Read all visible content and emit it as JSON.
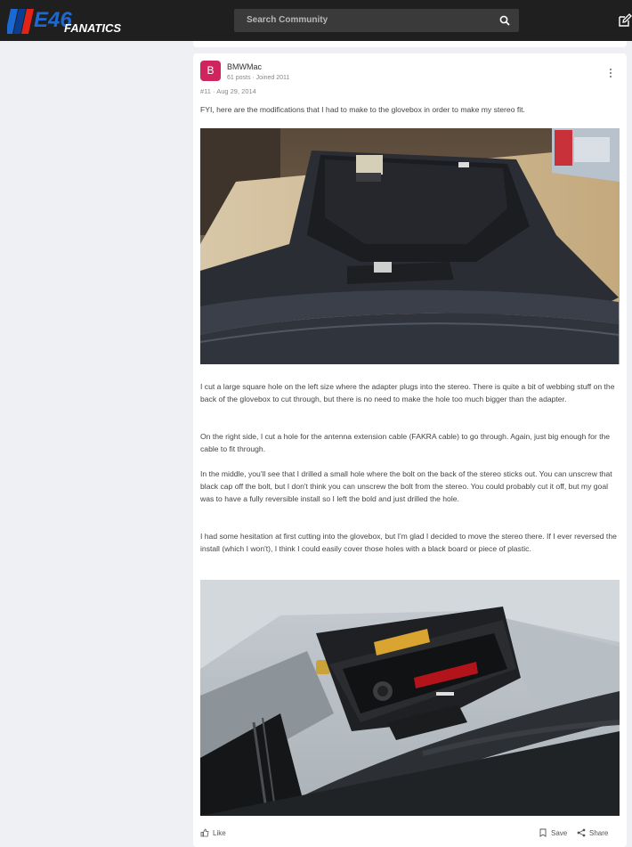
{
  "header": {
    "logo": {
      "big": "E46",
      "small": "FANATICS"
    },
    "search_placeholder": "Search Community",
    "icons": {
      "search": "search-icon",
      "edit": "edit-icon"
    },
    "colors": {
      "bar": "#1f1f1f",
      "logo_blue": "#1c69d4",
      "logo_red": "#e2231a"
    }
  },
  "post": {
    "avatar_letter": "B",
    "avatar_color": "#d0245e",
    "username": "BMWMac",
    "user_meta": "61 posts · Joined 2011",
    "post_meta": "#11 · Aug 29, 2014",
    "intro": "FYI, here are the modifications that I had to make to the glovebox in order to make my stereo fit.",
    "paragraphs": [
      "I cut a large square hole on the left size where the adapter plugs into the stereo. There is quite a bit of webbing stuff on the back of the glovebox to cut through, but there is no need to make the hole too much bigger than the adapter.",
      "On the right side, I cut a hole for the antenna extension cable (FAKRA cable) to go through. Again, just big enough for the cable to fit through.",
      "In the middle, you'll see that I drilled a small hole where the bolt on the back of the stereo sticks out. You can unscrew that black cap off the bolt, but I don't think you can unscrew the bolt from the stereo. You could probably cut it off, but my goal was to have a fully reversible install so I left the bold and just drilled the hole.",
      "I had some hesitation at first cutting into the glovebox, but I'm glad I decided to move the stereo there. If I ever reversed the install (which I won't), I think I could easily cover those holes with a black board or piece of plastic."
    ],
    "actions": {
      "like": "Like",
      "save": "Save",
      "share": "Share"
    }
  }
}
